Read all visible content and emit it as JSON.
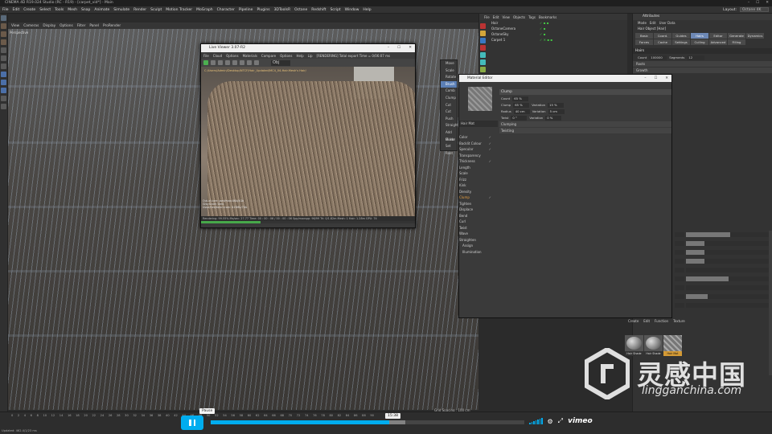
{
  "app": {
    "title": "CINEMA 4D R19.024 Studio (RC - R19) - [carpet_vid*] - Main",
    "window_controls": [
      "–",
      "☐",
      "✕"
    ],
    "menu": [
      "File",
      "Edit",
      "Create",
      "Select",
      "Tools",
      "Mesh",
      "Snap",
      "Animate",
      "Simulate",
      "Render",
      "Sculpt",
      "Motion Tracker",
      "MoGraph",
      "Character",
      "Pipeline",
      "Plugins",
      "3DToolsR",
      "Octane",
      "Redshift",
      "Script",
      "Window",
      "Help"
    ],
    "layout_label": "Layout:",
    "layout_value": "Octane 4K"
  },
  "viewport": {
    "menu": [
      "View",
      "Cameras",
      "Display",
      "Options",
      "Filter",
      "Panel",
      "ProRender"
    ],
    "label": "Perspective",
    "grid_spacing": "Grid Spacing : 100 cm"
  },
  "live_viewer": {
    "title": "Live Viewer 3.07-R2",
    "menu": [
      "File",
      "Cloud",
      "Options",
      "Materials",
      "Compare",
      "Options",
      "Help",
      "Lip",
      "[RENDERING] Total export Time = 0/06:07 ms"
    ],
    "zoom": "Obj",
    "path": "C:/Users/Admin/Desktop/NTCF/Hair_Updated/MC4_04-Hair.Mesh's Hair/",
    "stats": [
      "Out-of-core used/max:0Kb/4Gb",
      "GrayScale: 0mb",
      "Used/free/total vram: 819Mb/7Gb",
      "Rendering: 99.55%   Ms/sec: 27.77   Time: 00:00:06/00:00:06   Spp/maxspp: 96/99   Tri: 0/1.82m   Mesh: 1   Hair: 1.28m   GPU: 74"
    ],
    "status": "Rendering: 99.55%   Ms/sec: 27.77   Time: 00 : 00 : 06 / 00 : 00 : 06   Spp/maxspp: 96/99   Tri: 0/1.82m   Mesh: 1   Hair: 1.28m   GPU: 74",
    "progress": 0.28
  },
  "brush_menu": {
    "items": [
      "Move",
      "Scale",
      "Rotate",
      "Brush",
      "Comb",
      "Clump",
      "Cut",
      "Cut",
      "Push",
      "Straighten",
      "Add Guide",
      "Mirror",
      "Set Root"
    ],
    "selected_index": 3
  },
  "material_editor": {
    "title": "Material Editor",
    "material_name": "Hair Mat",
    "channels": [
      {
        "label": "Color",
        "on": true
      },
      {
        "label": "Backlit Colour",
        "on": true
      },
      {
        "label": "Specular",
        "on": true
      },
      {
        "label": "Transparency",
        "on": false
      },
      {
        "label": "Thickness",
        "on": true
      },
      {
        "label": "Length",
        "on": false
      },
      {
        "label": "Scale",
        "on": false
      },
      {
        "label": "Frizz",
        "on": false
      },
      {
        "label": "Kink",
        "on": false
      },
      {
        "label": "Density",
        "on": false
      },
      {
        "label": "Clump",
        "on": true
      },
      {
        "label": "Tighten",
        "on": false
      },
      {
        "label": "Displace",
        "on": false
      },
      {
        "label": "Bend",
        "on": false
      },
      {
        "label": "Curl",
        "on": false
      },
      {
        "label": "Twist",
        "on": false
      },
      {
        "label": "Wave",
        "on": false
      },
      {
        "label": "Straighten",
        "on": false
      }
    ],
    "selected_channel_index": 10,
    "extra_items": [
      "Assign",
      "Illumination"
    ],
    "section_title": "Clump",
    "params": [
      {
        "label": "Count",
        "value": "65 %"
      },
      {
        "label": "Clump",
        "value": "65 %",
        "var_label": "Variation",
        "var_value": "15 %"
      },
      {
        "label": "Radius",
        "value": "40 cm",
        "var_label": "Variation",
        "var_value": "5 cm"
      },
      {
        "label": "Twist",
        "value": "0 °",
        "var_label": "Variation",
        "var_value": "0 %"
      }
    ],
    "groups": [
      "Clumping",
      "Twisting"
    ]
  },
  "object_manager": {
    "menu": [
      "File",
      "Edit",
      "View",
      "Objects",
      "Tags",
      "Bookmarks"
    ],
    "objects": [
      {
        "name": "Hair",
        "tags": "✓ ▪ ▪"
      },
      {
        "name": "OctaneCamera",
        "tags": "✓ ▪"
      },
      {
        "name": "OctaneSky",
        "tags": "✓ ▪"
      },
      {
        "name": "Carpet 1",
        "tags": "✓ ✕ ▪ ▪"
      }
    ]
  },
  "attribute_manager": {
    "title": "Attributes",
    "menu": [
      "Mode",
      "Edit",
      "User Data"
    ],
    "object_label": "Hair Object [Hair]",
    "tabs": [
      "Basic",
      "Coord.",
      "Guides",
      "Hairs",
      "Editor",
      "Generate",
      "Dynamics",
      "Forces",
      "Cache",
      "Settings",
      "Culling",
      "Advanced",
      "Filling"
    ],
    "active_tab": "Hairs",
    "section": "Hairs",
    "count_label": "Count",
    "count_value": "100000",
    "segments_label": "Segments",
    "segments_value": "12",
    "roots": "Roots",
    "growth": "Growth",
    "slider_fills": [
      0.52,
      0.22,
      0.22,
      0.22,
      0.0,
      0.5,
      0.0,
      0.25,
      0.0
    ]
  },
  "material_strip": {
    "tabs": [
      "Create",
      "Edit",
      "Function",
      "Texture"
    ],
    "materials": [
      {
        "name": "Hair Shade",
        "hatch": false,
        "selected": false
      },
      {
        "name": "Hair Shade",
        "hatch": false,
        "selected": false
      },
      {
        "name": "Hair Mat",
        "hatch": true,
        "selected": true
      }
    ]
  },
  "timeline": {
    "ticks": [
      "0",
      "2",
      "4",
      "6",
      "8",
      "10",
      "12",
      "14",
      "16",
      "18",
      "20",
      "22",
      "24",
      "26",
      "28",
      "30",
      "32",
      "34",
      "36",
      "38",
      "40",
      "42",
      "44",
      "46",
      "48",
      "50",
      "52",
      "54",
      "56",
      "58",
      "60",
      "62",
      "64",
      "66",
      "68",
      "70",
      "72",
      "74",
      "76",
      "78",
      "80",
      "82",
      "84",
      "86",
      "88",
      "90"
    ],
    "status": "Updated: 462.4/1/23 ms"
  },
  "player": {
    "pause_tooltip": "Pause",
    "time": "15:38",
    "played_fraction": 0.57,
    "buffered_fraction": 0.62,
    "brand": "vimeo",
    "accent": "#00adef"
  },
  "watermark": {
    "brand_cn": "灵感中国",
    "url": "lingganchina.com"
  }
}
